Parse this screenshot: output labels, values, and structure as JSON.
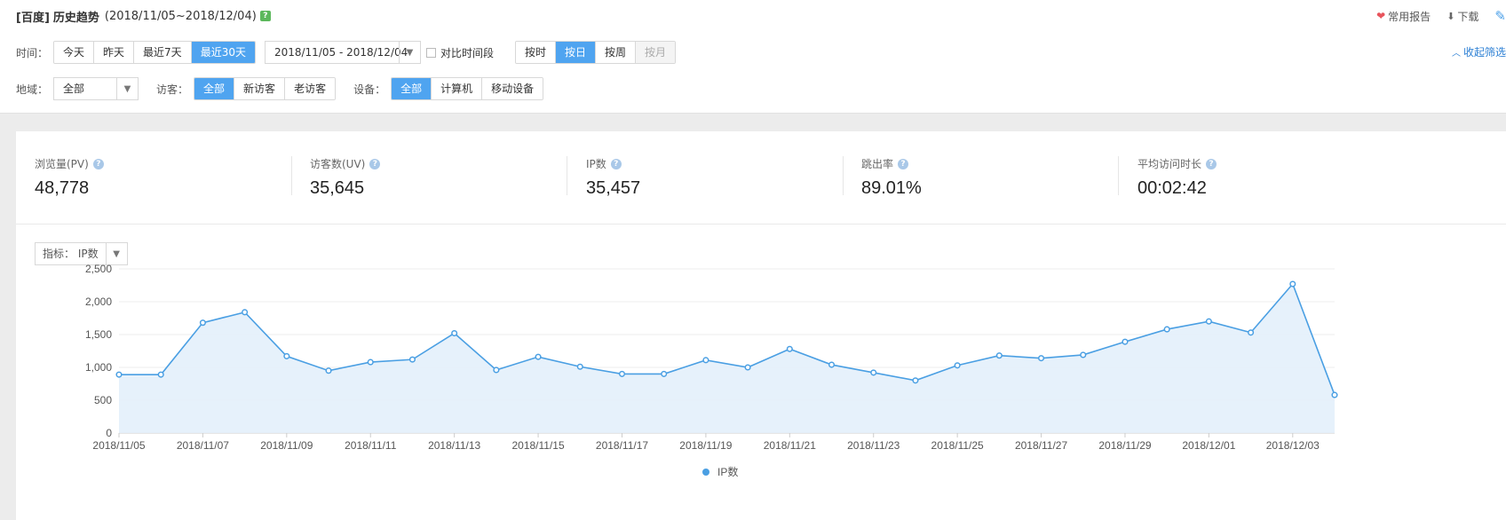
{
  "header": {
    "source": "[百度]",
    "title": "历史趋势",
    "date_range": "(2018/11/05~2018/12/04)",
    "help_badge": "?"
  },
  "top_actions": {
    "favorite_label": "常用报告",
    "download_label": "下载",
    "favorite_icon": "heart-icon",
    "download_icon": "download-icon",
    "pin_icon": "pin-icon"
  },
  "filters": {
    "time_label": "时间：",
    "time_buttons": [
      "今天",
      "昨天",
      "最近7天",
      "最近30天"
    ],
    "time_active": "最近30天",
    "date_picker_value": "2018/11/05 - 2018/12/04",
    "compare_label": "对比时间段",
    "granularity_buttons": [
      "按时",
      "按日",
      "按周",
      "按月"
    ],
    "granularity_active": "按日",
    "granularity_disabled": "按月",
    "collapse_label": "收起筛选",
    "region_label": "地域：",
    "region_value": "全部",
    "visitor_label": "访客：",
    "visitor_buttons": [
      "全部",
      "新访客",
      "老访客"
    ],
    "visitor_active": "全部",
    "device_label": "设备：",
    "device_buttons": [
      "全部",
      "计算机",
      "移动设备"
    ],
    "device_active": "全部"
  },
  "kpis": [
    {
      "label": "浏览量(PV)",
      "value": "48,778"
    },
    {
      "label": "访客数(UV)",
      "value": "35,645"
    },
    {
      "label": "IP数",
      "value": "35,457"
    },
    {
      "label": "跳出率",
      "value": "89.01%"
    },
    {
      "label": "平均访问时长",
      "value": "00:02:42"
    }
  ],
  "metric_select": {
    "label": "指标：",
    "value": "IP数"
  },
  "colors": {
    "accent": "#4fa4f0",
    "line": "#4a9fe3",
    "area": "#e3effb",
    "link": "#2b7fd4"
  },
  "chart_data": {
    "type": "area",
    "legend": "IP数",
    "legend_position": "bottom-center",
    "grid": true,
    "ylim": [
      0,
      2500
    ],
    "yticks": [
      0,
      500,
      1000,
      1500,
      2000,
      2500
    ],
    "ytick_labels": [
      "0",
      "500",
      "1,000",
      "1,500",
      "2,000",
      "2,500"
    ],
    "x": [
      "2018/11/05",
      "2018/11/06",
      "2018/11/07",
      "2018/11/08",
      "2018/11/09",
      "2018/11/10",
      "2018/11/11",
      "2018/11/12",
      "2018/11/13",
      "2018/11/14",
      "2018/11/15",
      "2018/11/16",
      "2018/11/17",
      "2018/11/18",
      "2018/11/19",
      "2018/11/20",
      "2018/11/21",
      "2018/11/22",
      "2018/11/23",
      "2018/11/24",
      "2018/11/25",
      "2018/11/26",
      "2018/11/27",
      "2018/11/28",
      "2018/11/29",
      "2018/11/30",
      "2018/12/01",
      "2018/12/02",
      "2018/12/03",
      "2018/12/04"
    ],
    "xtick_labels": [
      "2018/11/05",
      "2018/11/07",
      "2018/11/09",
      "2018/11/11",
      "2018/11/13",
      "2018/11/15",
      "2018/11/17",
      "2018/11/19",
      "2018/11/21",
      "2018/11/23",
      "2018/11/25",
      "2018/11/27",
      "2018/11/29",
      "2018/12/01",
      "2018/12/03"
    ],
    "series": [
      {
        "name": "IP数",
        "values": [
          890,
          890,
          1680,
          1840,
          1170,
          950,
          1080,
          1120,
          1520,
          960,
          1160,
          1010,
          900,
          900,
          1110,
          1000,
          1280,
          1040,
          920,
          800,
          1030,
          1180,
          1140,
          1190,
          1390,
          1580,
          1700,
          1530,
          2270,
          580
        ]
      }
    ]
  }
}
